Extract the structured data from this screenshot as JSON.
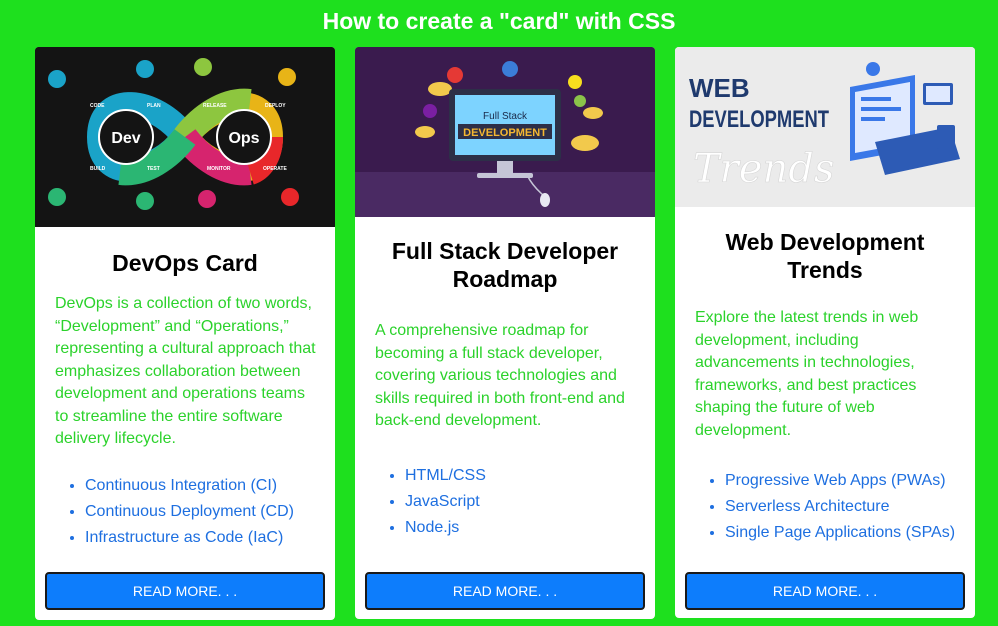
{
  "page": {
    "title": "How to create a \"card\" with CSS",
    "background_color": "#1ee01e"
  },
  "cards": [
    {
      "image": {
        "labels": [
          "Dev",
          "Ops",
          "CODE",
          "PLAN",
          "RELEASE",
          "DEPLOY",
          "BUILD",
          "TEST",
          "MONITOR",
          "OPERATE"
        ]
      },
      "title": "DevOps Card",
      "description": "DevOps is a collection of two words, “Development” and “Operations,” representing a cultural approach that emphasizes collaboration between development and operations teams to streamline the entire software delivery lifecycle.",
      "items": [
        "Continuous Integration (CI)",
        "Continuous Deployment (CD)",
        "Infrastructure as Code (IaC)"
      ],
      "button_label": "READ MORE. . ."
    },
    {
      "image": {
        "labels": [
          "Full Stack",
          "DEVELOPMENT"
        ]
      },
      "title": "Full Stack Developer Roadmap",
      "description": "A comprehensive roadmap for becoming a full stack developer, covering various technologies and skills required in both front-end and back-end development.",
      "items": [
        "HTML/CSS",
        "JavaScript",
        "Node.js"
      ],
      "button_label": "READ MORE. . ."
    },
    {
      "image": {
        "labels": [
          "WEB",
          "DEVELOPMENT",
          "Trends"
        ]
      },
      "title": "Web Development Trends",
      "description": "Explore the latest trends in web development, including advancements in technologies, frameworks, and best practices shaping the future of web development.",
      "items": [
        "Progressive Web Apps (PWAs)",
        "Serverless Architecture",
        "Single Page Applications (SPAs)"
      ],
      "button_label": "READ MORE. . ."
    }
  ],
  "colors": {
    "description_text": "#2bd22b",
    "list_text": "#1e6fe0",
    "button_bg": "#0d7dfc"
  }
}
